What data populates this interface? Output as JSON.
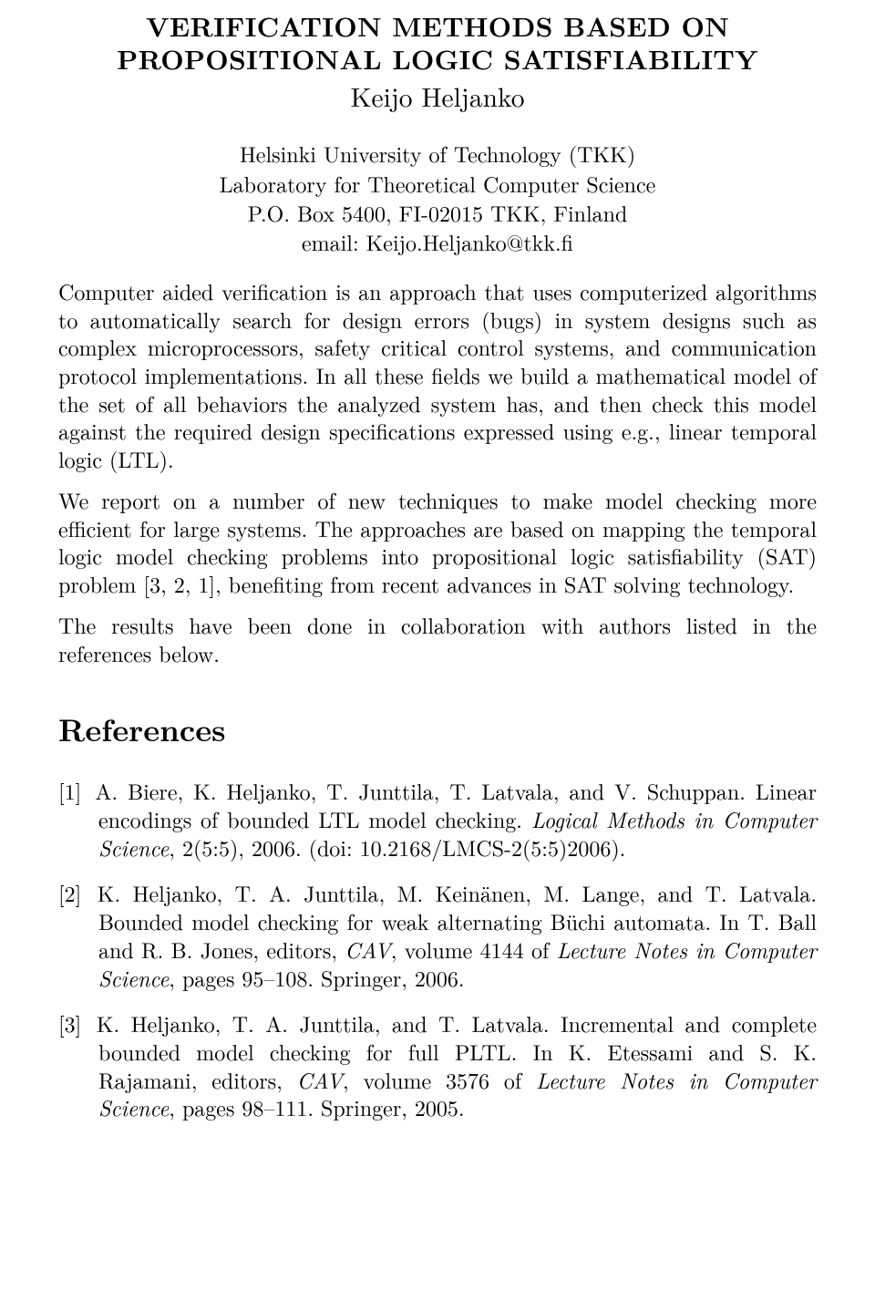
{
  "title": {
    "line1": "VERIFICATION METHODS BASED ON",
    "line2": "PROPOSITIONAL LOGIC SATISFIABILITY",
    "author": "Keijo Heljanko"
  },
  "affiliation": {
    "l1": "Helsinki University of Technology (TKK)",
    "l2": "Laboratory for Theoretical Computer Science",
    "l3": "P.O. Box 5400, FI-02015 TKK, Finland",
    "l4": "email: Keijo.Heljanko@tkk.fi"
  },
  "body": {
    "p1": "Computer aided verification is an approach that uses computerized algorithms to automatically search for design errors (bugs) in system designs such as complex microprocessors, safety critical control systems, and communication protocol implementations. In all these fields we build a mathematical model of the set of all behaviors the analyzed system has, and then check this model against the required design specifications expressed using e.g., linear temporal logic (LTL).",
    "p2": "We report on a number of new techniques to make model checking more efficient for large systems. The approaches are based on mapping the temporal logic model checking problems into propositional logic satisfiability (SAT) problem [3, 2, 1], benefiting from recent advances in SAT solving technology.",
    "p3": "The results have been done in collaboration with authors listed in the references below."
  },
  "references": {
    "heading": "References",
    "r1": {
      "label": "[1]",
      "a": "A. Biere, K. Heljanko, T. Junttila, T. Latvala, and V. Schuppan. Linear encodings of bounded LTL model checking. ",
      "j": "Logical Methods in Computer Science",
      "b": ", 2(5:5), 2006. (doi: 10.2168/LMCS-2(5:5)2006)."
    },
    "r2": {
      "label": "[2]",
      "a": "K. Heljanko, T. A. Junttila, M. Keinänen, M. Lange, and T. Latvala. Bounded model checking for weak alternating Büchi automata. In T. Ball and R. B. Jones, editors, ",
      "j1": "CAV",
      "b": ", volume 4144 of ",
      "j2": "Lecture Notes in Computer Science",
      "c": ", pages 95–108. Springer, 2006."
    },
    "r3": {
      "label": "[3]",
      "a": "K. Heljanko, T. A. Junttila, and T. Latvala. Incremental and complete bounded model checking for full PLTL. In K. Etessami and S. K. Rajamani, editors, ",
      "j1": "CAV",
      "b": ", volume 3576 of ",
      "j2": "Lecture Notes in Computer Science",
      "c": ", pages 98–111. Springer, 2005."
    }
  }
}
